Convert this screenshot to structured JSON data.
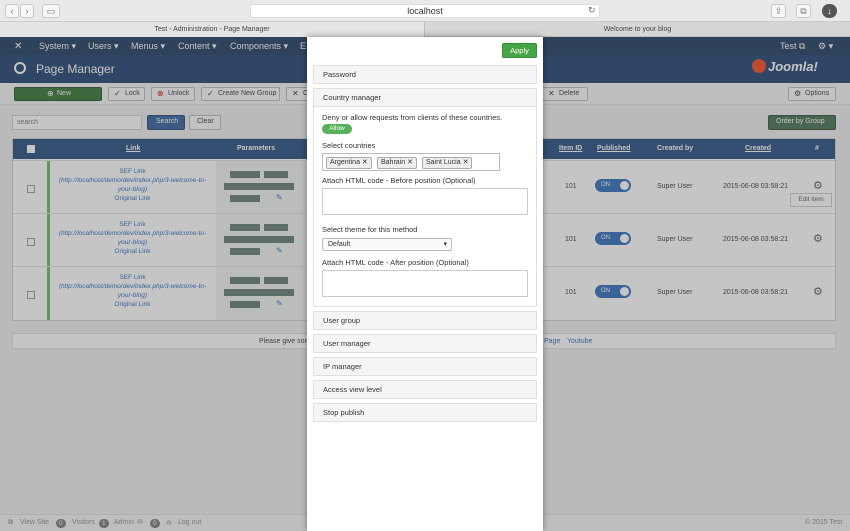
{
  "browser": {
    "url": "localhost",
    "tabs": [
      "Test - Administration - Page Manager",
      "Welcome to your blog"
    ]
  },
  "nav": {
    "items": [
      "System ▾",
      "Users ▾",
      "Menus ▾",
      "Content ▾",
      "Components ▾",
      "E"
    ],
    "user": "Test ⧉",
    "gear": "⚙ ▾"
  },
  "header": {
    "title": "Page Manager",
    "logo": "Joomla!"
  },
  "toolbar": {
    "new": "New",
    "lock": "Lock",
    "unlock": "Unlock",
    "create_group": "Create New Group",
    "c": "C",
    "delete": "Delete",
    "options": "Options"
  },
  "filter": {
    "search_placeholder": "search",
    "search_btn": "Search",
    "clear_btn": "Clear",
    "order_btn": "Order by Group"
  },
  "table": {
    "headers": [
      "Link",
      "Parameters",
      "Item ID",
      "Published",
      "Created by",
      "Created",
      "#"
    ],
    "rows": [
      {
        "sef": "SEF Link",
        "url": "(http://localhost/demo/dev/index.php/3-welcome-to-your-blog)",
        "orig": "Original Link",
        "id": "101",
        "pub": "ON",
        "by": "Super User",
        "date": "2015-06-08 03:58:21"
      },
      {
        "sef": "SEF Link",
        "url": "(http://localhost/demo/dev/index.php/3-welcome-to-your-blog)",
        "orig": "Original Link",
        "id": "101",
        "pub": "ON",
        "by": "Super User",
        "date": "2015-06-08 03:58:21"
      },
      {
        "sef": "SEF Link",
        "url": "(http://localhost/demo/dev/index.php/3-welcome-to-your-blog)",
        "orig": "Original Link",
        "id": "101",
        "pub": "ON",
        "by": "Super User",
        "date": "2015-06-08 03:58:21"
      }
    ],
    "edit_tooltip": "Edit item"
  },
  "notice": {
    "text": "Please give som",
    "links": [
      "Page",
      "Youtube"
    ]
  },
  "modal": {
    "apply": "Apply",
    "sections_top": [
      "Password",
      "Country manager"
    ],
    "country": {
      "desc": "Deny or allow requests from clients of these countries.",
      "allow": "Allow",
      "select_label": "Select countries",
      "chips": [
        "Argentina",
        "Bahrain",
        "Saint Lucia"
      ],
      "before_label": "Attach HTML code - Before position (Optional)",
      "theme_label": "Select theme for this method",
      "theme_value": "Default",
      "after_label": "Attach HTML code - After position (Optional)"
    },
    "sections_bottom": [
      "User group",
      "User manager",
      "IP manager",
      "Access view level",
      "Stop publish"
    ]
  },
  "footer": {
    "view_site": "View Site",
    "visitors": "Visitors",
    "visitors_n": "0",
    "admin": "Admin",
    "admin_n": "1",
    "mail_n": "0",
    "logout": "Log out",
    "copy": "© 2015 Test"
  }
}
